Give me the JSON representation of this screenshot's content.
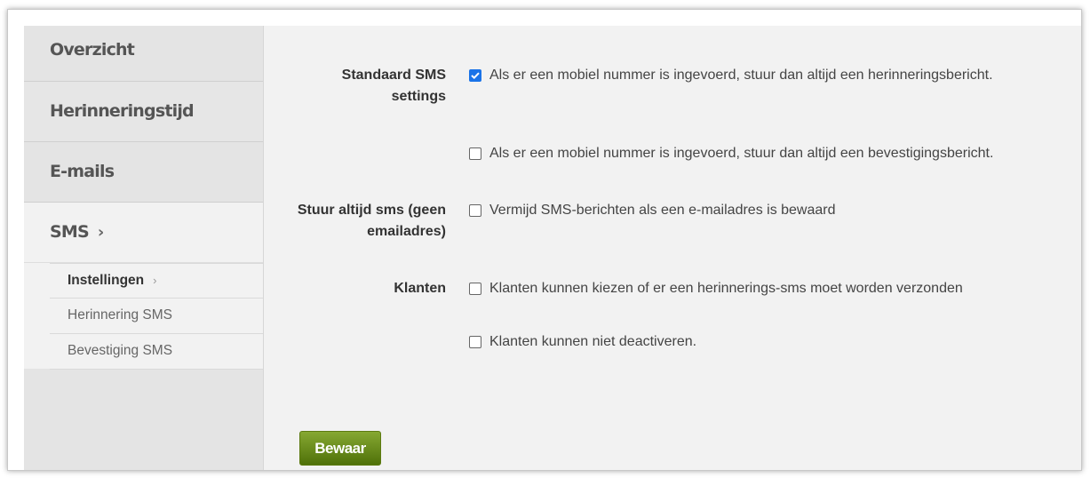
{
  "sidebar": {
    "items": [
      {
        "label": "Overzicht"
      },
      {
        "label": "Herinneringstijd"
      },
      {
        "label": "E-mails"
      },
      {
        "label": "SMS",
        "chevron": "›"
      }
    ],
    "subitems": [
      {
        "label": "Instellingen",
        "chevron": "›",
        "active": true
      },
      {
        "label": "Herinnering SMS"
      },
      {
        "label": "Bevestiging SMS"
      }
    ]
  },
  "settings": {
    "standard": {
      "label_line1": "Standaard SMS",
      "label_line2": "settings",
      "option1": {
        "text": "Als er een mobiel nummer is ingevoerd, stuur dan altijd een herinneringsbericht.",
        "checked": true
      },
      "option2": {
        "text": "Als er een mobiel nummer is ingevoerd, stuur dan altijd een bevestigingsbericht.",
        "checked": false
      }
    },
    "always_sms": {
      "label_line1": "Stuur altijd sms (geen",
      "label_line2": "emailadres)",
      "option": {
        "text": "Vermijd SMS-berichten als een e-mailadres is bewaard",
        "checked": false
      }
    },
    "customers": {
      "label": "Klanten",
      "option1": {
        "text": "Klanten kunnen kiezen of er een herinnerings-sms moet worden verzonden",
        "checked": false
      },
      "option2": {
        "text": "Klanten kunnen niet deactiveren.",
        "checked": false
      }
    }
  },
  "save_button": {
    "label": "Bewaar"
  },
  "colors": {
    "checkbox_checked": "#1a73e8",
    "save_button": "#6b8e1e"
  }
}
